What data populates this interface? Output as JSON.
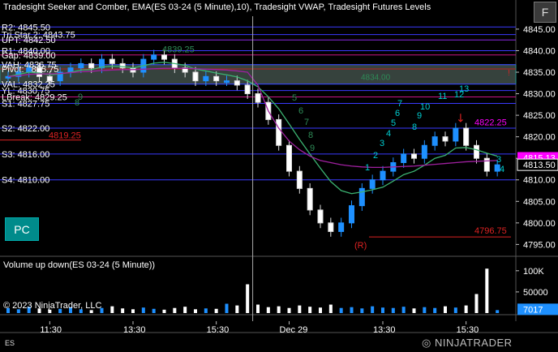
{
  "chart_title": "Tradesight Seeker and Comber, EMA(ES 03-24 (5 Minute),10), Tradesight VWAP, Tradesight Futures Levels",
  "volume_title": "Volume up down(ES 03-24 (5 Minute))",
  "copyright": "© 2023 NinjaTrader, LLC",
  "instrument_code": "ES",
  "logo_text": "NINJATRADER",
  "buttons": {
    "f_label": "F",
    "pc_label": "PC"
  },
  "colors": {
    "background": "#000000",
    "up_bar": "#1e90ff",
    "down_bar": "#ffffff",
    "ema": "#2e8b57",
    "vwap": "#8b008b",
    "level_line": "#3a3aff"
  },
  "price_axis": {
    "ticks": [
      "4845.00",
      "4840.00",
      "4835.00",
      "4830.00",
      "4825.00",
      "4820.00",
      "4815.00",
      "4810.00",
      "4805.00",
      "4800.00",
      "4795.00"
    ],
    "current_price": "4813.50",
    "vwap_price": "4815.13",
    "marker_4835": "4835.00"
  },
  "volume_axis": {
    "ticks": [
      "100K",
      "50000"
    ],
    "current_volume": "7017"
  },
  "time_axis": {
    "ticks": [
      "11:30",
      "13:30",
      "15:30",
      "Dec 29",
      "13:30",
      "15:30"
    ]
  },
  "levels": [
    {
      "label": "R2: 4845.50"
    },
    {
      "label": "Tri Star 2: 4843.75"
    },
    {
      "label": "UPT: 4842.50"
    },
    {
      "label": "R1: 4840.00"
    },
    {
      "label": "Gap: 4839.00"
    },
    {
      "label": "VAH: 4836.75"
    },
    {
      "label": "Pivot: 4835.75"
    },
    {
      "label": "VAL: 4832.25"
    },
    {
      "label": "YL: 4830.75"
    },
    {
      "label": "LBreak: 4829.25"
    },
    {
      "label": "S1: 4827.75"
    },
    {
      "label": "S2: 4822.00"
    },
    {
      "label": "S3: 4816.00"
    },
    {
      "label": "S4: 4810.00"
    }
  ],
  "annotations": {
    "high_day1": "4839.25",
    "mid_box": "4834.00",
    "level_4819": "4819.25",
    "high_day2": "4822.25",
    "low_day2": "4796.75",
    "reversal": "(R)"
  },
  "chart_data": {
    "type": "candlestick",
    "title": "Tradesight Seeker and Comber, EMA(ES 03-24 (5 Minute),10), Tradesight VWAP, Tradesight Futures Levels",
    "ylim": [
      4793,
      4848
    ],
    "x_ticks": [
      "11:30",
      "13:30",
      "15:30",
      "Dec 29",
      "13:30",
      "15:30"
    ],
    "y_ticks": [
      4845,
      4840,
      4835,
      4830,
      4825,
      4820,
      4815,
      4810,
      4805,
      4800,
      4795
    ],
    "close_series": [
      4834,
      4835,
      4836,
      4834,
      4833,
      4835,
      4836,
      4837,
      4836,
      4838,
      4837,
      4836,
      4835,
      4838,
      4839,
      4838,
      4836,
      4835,
      4833,
      4834,
      4833,
      4833,
      4832,
      4830,
      4828,
      4824,
      4818,
      4812,
      4808,
      4803,
      4800,
      4798,
      4800,
      4804,
      4808,
      4810,
      4812,
      4814,
      4816,
      4815,
      4818,
      4820,
      4819,
      4822,
      4818,
      4815,
      4812,
      4813.5
    ],
    "series": [
      {
        "name": "EMA",
        "values": [
          4834,
          4834.5,
          4835,
          4834.8,
          4834.4,
          4834.6,
          4835,
          4835.5,
          4835.6,
          4836.2,
          4836.4,
          4836.3,
          4836,
          4836.5,
          4837.1,
          4837.3,
          4837,
          4836.6,
          4835.7,
          4835.3,
          4834.8,
          4834.4,
          4833.9,
          4833,
          4831.6,
          4829.3,
          4826.5,
          4823,
          4819.4,
          4816,
          4812.7,
          4809.6,
          4807.5,
          4806.8,
          4807.2,
          4807.7,
          4808.3,
          4809.7,
          4811.2,
          4812,
          4813.4,
          4815,
          4815.7,
          4817.4,
          4817.5,
          4817,
          4816.2,
          4815.5
        ]
      },
      {
        "name": "VWAP",
        "values": [
          4834,
          4834.2,
          4834.5,
          4834.6,
          4834.6,
          4834.7,
          4834.9,
          4835.1,
          4835.2,
          4835.4,
          4835.5,
          4835.6,
          4835.6,
          4835.7,
          4835.8,
          4835.9,
          4835.9,
          4835.9,
          4835.8,
          4835.7,
          4835.6,
          4835.5,
          4835.3,
          4835,
          4832,
          4826,
          4822,
          4819,
          4817,
          4815.5,
          4814.5,
          4814,
          4813.5,
          4813.2,
          4813,
          4812.9,
          4812.9,
          4813,
          4813.1,
          4813.2,
          4813.4,
          4813.6,
          4813.8,
          4814,
          4814.2,
          4814.3,
          4814.4,
          4814.5
        ]
      }
    ],
    "volume_ylim": [
      0,
      115000
    ],
    "volume_y_ticks": [
      100000,
      50000
    ],
    "volume_series": [
      12000,
      9000,
      15000,
      11000,
      8000,
      10000,
      14000,
      9000,
      7000,
      12000,
      16000,
      11000,
      9000,
      13000,
      10000,
      8000,
      12000,
      15000,
      9000,
      11000,
      10000,
      22000,
      18000,
      68000,
      20000,
      14000,
      16000,
      12000,
      18000,
      15000,
      13000,
      20000,
      12000,
      14000,
      11000,
      16000,
      13000,
      12000,
      15000,
      11000,
      14000,
      12000,
      16000,
      13000,
      18000,
      45000,
      105000,
      7017
    ]
  }
}
